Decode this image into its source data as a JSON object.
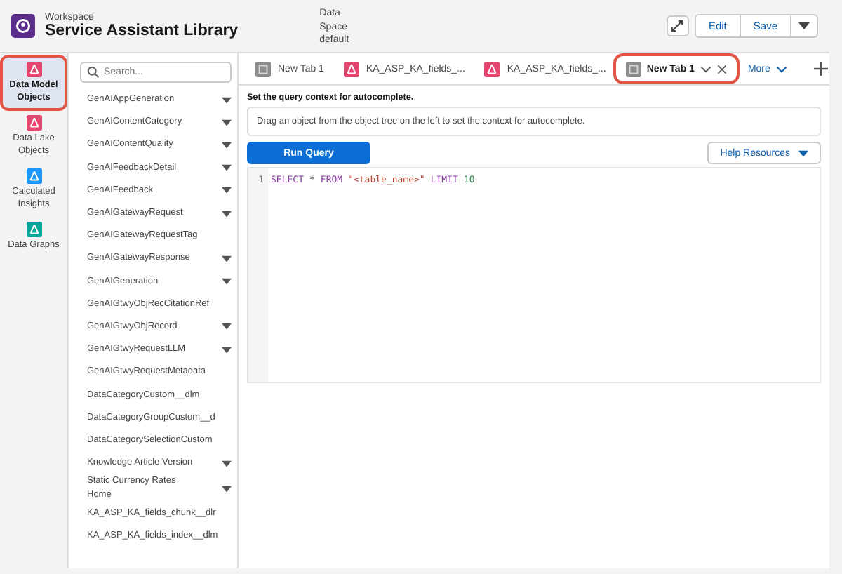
{
  "header": {
    "label": "Workspace",
    "title": "Service Assistant Library",
    "data_space_label": "Data Space",
    "data_space_value": "default",
    "buttons": [
      "Edit",
      "Save"
    ]
  },
  "nav": [
    {
      "label": "Data Model Objects",
      "selected": true,
      "highlighted": true,
      "color": "#e3466f"
    },
    {
      "label": "Data Lake Objects",
      "selected": false,
      "highlighted": false,
      "color": "#e3466f"
    },
    {
      "label": "Calculated Insights",
      "selected": false,
      "highlighted": false,
      "color": "#1b96ff"
    },
    {
      "label": "Data Graphs",
      "selected": false,
      "highlighted": false,
      "color": "#06a59a"
    }
  ],
  "search": {
    "placeholder": "Search..."
  },
  "objects": [
    {
      "name": "GenAIAppGeneration",
      "expandable": true
    },
    {
      "name": "GenAIContentCategory",
      "expandable": true
    },
    {
      "name": "GenAIContentQuality",
      "expandable": true
    },
    {
      "name": "GenAIFeedbackDetail",
      "expandable": true
    },
    {
      "name": "GenAIFeedback",
      "expandable": true
    },
    {
      "name": "GenAIGatewayRequest",
      "expandable": true
    },
    {
      "name": "GenAIGatewayRequestTag",
      "expandable": false
    },
    {
      "name": "GenAIGatewayResponse",
      "expandable": true
    },
    {
      "name": "GenAIGeneration",
      "expandable": true
    },
    {
      "name": "GenAIGtwyObjRecCitationRef",
      "expandable": false
    },
    {
      "name": "GenAIGtwyObjRecord",
      "expandable": true
    },
    {
      "name": "GenAIGtwyRequestLLM",
      "expandable": true
    },
    {
      "name": "GenAIGtwyRequestMetadata",
      "expandable": false
    },
    {
      "name": "DataCategoryCustom__dlm",
      "expandable": false
    },
    {
      "name": "DataCategoryGroupCustom__d",
      "expandable": false
    },
    {
      "name": "DataCategorySelectionCustom",
      "expandable": false
    },
    {
      "name": "Knowledge Article Version",
      "expandable": true
    },
    {
      "name": "Static Currency Rates Home",
      "expandable": true
    },
    {
      "name": "KA_ASP_KA_fields_chunk__dlr",
      "expandable": false
    },
    {
      "name": "KA_ASP_KA_fields_index__dlm",
      "expandable": false
    }
  ],
  "tabs": [
    {
      "label": "New Tab 1",
      "kind": "query",
      "selected": false,
      "highlighted": false
    },
    {
      "label": "KA_ASP_KA_fields_...",
      "kind": "object",
      "selected": false,
      "highlighted": false
    },
    {
      "label": "KA_ASP_KA_fields_...",
      "kind": "object",
      "selected": false,
      "highlighted": false
    },
    {
      "label": "New Tab 1",
      "kind": "query",
      "selected": true,
      "highlighted": true
    }
  ],
  "more_label": "More",
  "context_hint": "Set the query context for autocomplete.",
  "drop_hint": "Drag an object from the object tree on the left to set the context for autocomplete.",
  "run_button": "Run Query",
  "help_button": "Help Resources",
  "editor": {
    "lines": [
      {
        "number": "1",
        "tokens": [
          {
            "text": "SELECT",
            "kind": "keyword"
          },
          {
            "text": "*",
            "kind": "plain"
          },
          {
            "text": "FROM",
            "kind": "keyword"
          },
          {
            "text": "\"<table_name>\"",
            "kind": "string"
          },
          {
            "text": "LIMIT",
            "kind": "keyword"
          },
          {
            "text": "10",
            "kind": "number"
          }
        ]
      }
    ]
  }
}
